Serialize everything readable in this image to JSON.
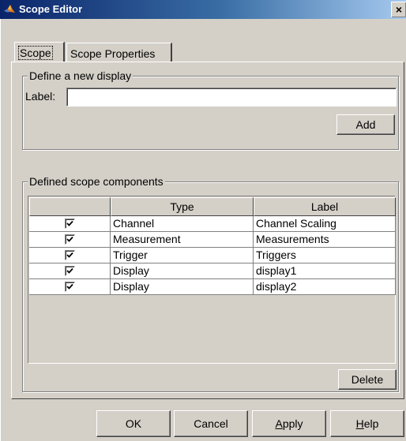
{
  "window": {
    "title": "Scope Editor",
    "close_glyph": "×"
  },
  "tabs": [
    {
      "label": "Scope",
      "active": true
    },
    {
      "label": "Scope Properties",
      "active": false
    }
  ],
  "new_display": {
    "group_title": "Define a new display",
    "label_caption": "Label:",
    "label_value": "",
    "add_button": "Add"
  },
  "components": {
    "group_title": "Defined scope components",
    "columns": [
      "",
      "Type",
      "Label"
    ],
    "rows": [
      {
        "checked": true,
        "type": "Channel",
        "label": "Channel Scaling"
      },
      {
        "checked": true,
        "type": "Measurement",
        "label": "Measurements"
      },
      {
        "checked": true,
        "type": "Trigger",
        "label": "Triggers"
      },
      {
        "checked": true,
        "type": "Display",
        "label": "display1"
      },
      {
        "checked": true,
        "type": "Display",
        "label": "display2"
      }
    ],
    "delete_button": "Delete"
  },
  "footer": {
    "ok": "OK",
    "cancel": "Cancel",
    "apply_mnemonic": "A",
    "apply_rest": "pply",
    "help_mnemonic": "H",
    "help_rest": "elp"
  }
}
